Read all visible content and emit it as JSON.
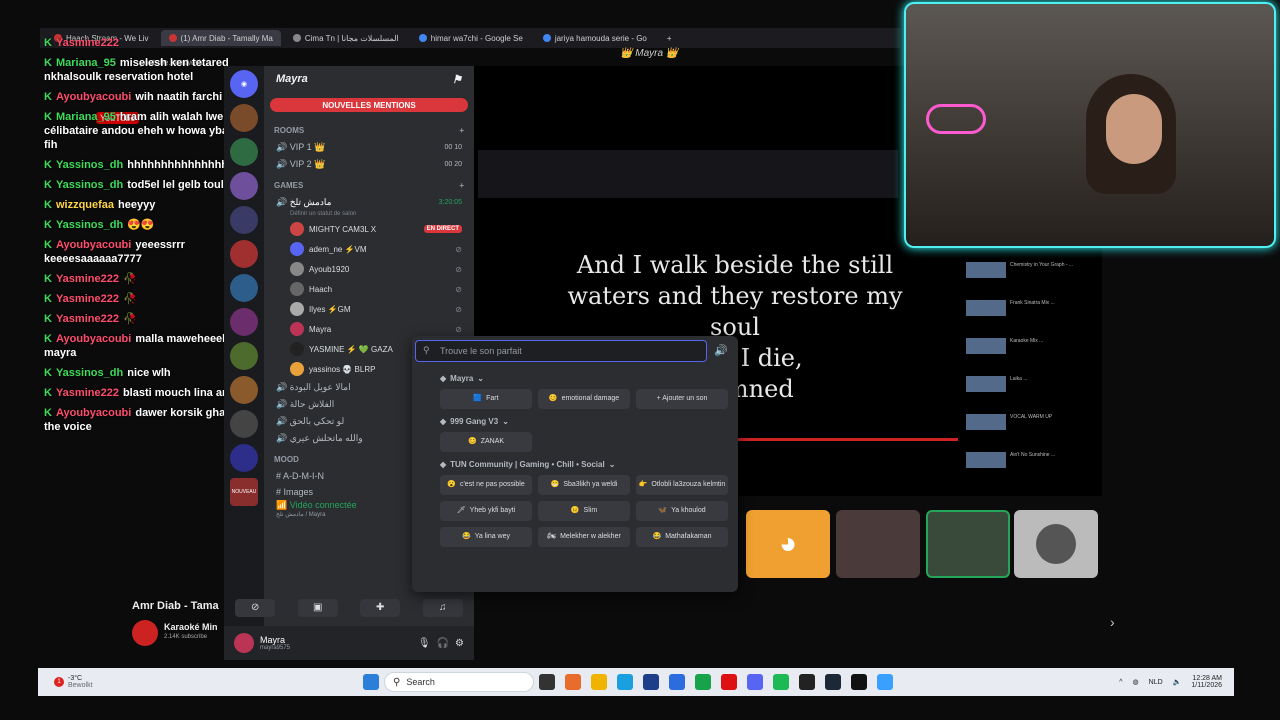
{
  "browser": {
    "tabs": [
      {
        "label": "Haach Stream - We Liv"
      },
      {
        "label": "(1) Amr Diab - Tamally Ma"
      },
      {
        "label": "Cima Tn | المسلسلات مجانا"
      },
      {
        "label": "himar wa7chi - Google Se"
      },
      {
        "label": "jariya hamouda serie - Go"
      }
    ],
    "url_fragment": "youtube.com/watc",
    "youtube_logo": "YouTube"
  },
  "chat": {
    "messages": [
      {
        "user": "Yasmine222",
        "text": "",
        "color": "#ff4d6d"
      },
      {
        "user": "Mariana_95",
        "text": "miselesh ken tetared nkhalsoulk reservation hotel",
        "color": "#3ddc5a"
      },
      {
        "user": "Ayoubyacoubi",
        "text": "wih naatih farchi",
        "color": "#ff4d6d"
      },
      {
        "user": "Mariana_95",
        "text": "hram alih walah lwehed célibataire andou eheh w howa ybarbesh fih",
        "color": "#3ddc5a"
      },
      {
        "user": "Yassinos_dh",
        "text": "hhhhhhhhhhhhhhhhhhhhhh",
        "color": "#3ddc5a"
      },
      {
        "user": "Yassinos_dh",
        "text": "tod5el lel gelb toul",
        "color": "#3ddc5a"
      },
      {
        "user": "wizzquefaa",
        "text": "heeyyy",
        "color": "#ffd54a"
      },
      {
        "user": "Yassinos_dh",
        "text": "😍😍",
        "color": "#3ddc5a"
      },
      {
        "user": "Ayoubyacoubi",
        "text": "yeeessrrr keeeesaaaaaa7777",
        "color": "#ff4d6d"
      },
      {
        "user": "Yasmine222",
        "text": "🥀",
        "color": "#ff4d6d"
      },
      {
        "user": "Yasmine222",
        "text": "🥀",
        "color": "#ff4d6d"
      },
      {
        "user": "Yasmine222",
        "text": "🥀",
        "color": "#ff4d6d"
      },
      {
        "user": "Ayoubyacoubi",
        "text": "malla maweheeeb f live mayra",
        "color": "#ff4d6d"
      },
      {
        "user": "Yassinos_dh",
        "text": "nice wlh",
        "color": "#3ddc5a"
      },
      {
        "user": "Yasmine222",
        "text": "blasti mouch lina ani",
        "color": "#ff4d6d"
      },
      {
        "user": "Ayoubyacoubi",
        "text": "dawer korsik ghadi kima the voice",
        "color": "#ff4d6d"
      }
    ]
  },
  "discord": {
    "server_name": "Mayra",
    "mentions_banner": "NOUVELLES MENTIONS",
    "rooms_category": "ROOMS",
    "rooms": [
      {
        "name": "VIP 1 👑",
        "count_a": "00",
        "count_b": "10"
      },
      {
        "name": "VIP 2 👑",
        "count_a": "00",
        "count_b": "20"
      }
    ],
    "games_category": "GAMES",
    "voice_channel": {
      "name": "مادمش تلخ",
      "time": "3:20:05",
      "status_hint": "Définir un statut de salon"
    },
    "voice_users": [
      {
        "name": "MIGHTY CAM3L X",
        "badge": "EN DIRECT"
      },
      {
        "name": "adem_ne ⚡VM",
        "badge": ""
      },
      {
        "name": "Ayoub1920",
        "badge": ""
      },
      {
        "name": "Haach",
        "badge": ""
      },
      {
        "name": "Ilyes ⚡GM",
        "badge": ""
      },
      {
        "name": "Mayra",
        "badge": ""
      },
      {
        "name": "YASMINE ⚡ 💚 GAZA",
        "badge": ""
      },
      {
        "name": "yassinos 💀 BLRP",
        "badge": ""
      }
    ],
    "other_channels": [
      "امالا عويل البودة",
      "الفلاش حالة",
      "لو تحكي بالحق",
      "والله ماتحلش عيري"
    ],
    "mood_category": "MOOD",
    "mood_channels": [
      "A-D-M-I-N",
      "Images"
    ],
    "connected_label": "Vidéo connectée",
    "connected_sub": "مادمش تلخ / Mayra",
    "user": {
      "name": "Mayra",
      "tag": "mayra9575"
    },
    "server_badges": [
      "NOUVEAU"
    ]
  },
  "soundboard": {
    "search_placeholder": "Trouve le son parfait",
    "sections": [
      {
        "title": "Mayra",
        "sounds": [
          {
            "label": "Fart",
            "icon": "🟦"
          },
          {
            "label": "emotional damage",
            "icon": "😊"
          },
          {
            "label": "+ Ajouter un son",
            "icon": ""
          }
        ]
      },
      {
        "title": "999 Gang V3",
        "sounds": [
          {
            "label": "ZANAK",
            "icon": "😊"
          }
        ]
      },
      {
        "title": "TUN Community | Gaming • Chill • Social",
        "sounds": [
          {
            "label": "c'est ne pas possible",
            "icon": "😮"
          },
          {
            "label": "Sba3likh ya weldi",
            "icon": "😁"
          },
          {
            "label": "Otlobli la3zouza kelmtin",
            "icon": "👉"
          },
          {
            "label": "Yheb ykfi bayti",
            "icon": "🗡"
          },
          {
            "label": "Slim",
            "icon": "😐"
          },
          {
            "label": "Ya khoulod",
            "icon": "🦋"
          },
          {
            "label": "Ya lina wey",
            "icon": "😂"
          },
          {
            "label": "Melekher w alekher",
            "icon": "🏍"
          },
          {
            "label": "Mathafakaman",
            "icon": "😂"
          }
        ]
      }
    ]
  },
  "video": {
    "title": "Mayra",
    "lyrics": [
      "And I walk beside the still",
      "waters and they restore my",
      "soul",
      "when I die,",
      "s damned"
    ]
  },
  "youtube": {
    "channel_title": "Amr Diab - Tama",
    "channel_name": "Karaoké Min",
    "subscribers": "2.14K subscribe",
    "sidebar_items": [
      "Chemistry in Your Graph - ...",
      "Frank Sinatra Mix ...",
      "Karaoke Mix ...",
      "Laika ...",
      "VOCAL WARM UP",
      "Ain't No Sunshine ..."
    ]
  },
  "taskbar": {
    "weather_temp": "-3°C",
    "weather_desc": "Bewolkt",
    "search_placeholder": "Search",
    "lang": "NLD",
    "time": "12:28 AM",
    "date": "1/11/2026",
    "notif_count": "1"
  }
}
